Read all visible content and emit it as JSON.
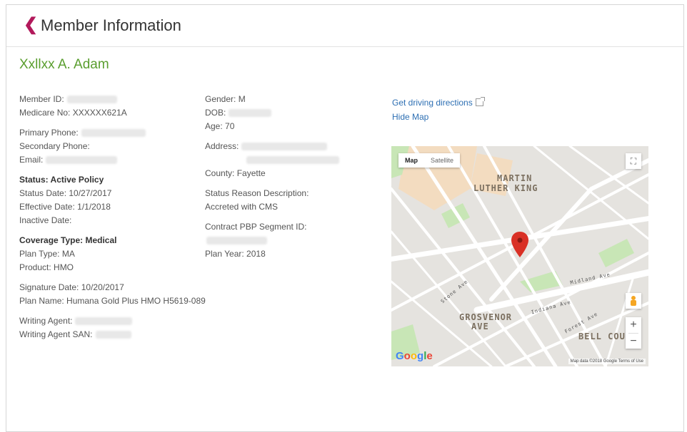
{
  "header": {
    "back_icon": "chevron-left-icon",
    "title": "Member Information"
  },
  "member": {
    "name": "Xxllxx A. Adam"
  },
  "left": {
    "member_id_label": "Member ID:",
    "medicare_label": "Medicare No: XXXXXX621A",
    "primary_phone_label": "Primary Phone:",
    "secondary_phone_label": "Secondary Phone:",
    "email_label": "Email:",
    "status_heading": "Status: Active Policy",
    "status_date": "Status Date: 10/27/2017",
    "effective_date": "Effective Date: 1/1/2018",
    "inactive_date": "Inactive Date:",
    "coverage_heading": "Coverage Type: Medical",
    "plan_type": "Plan Type: MA",
    "product": "Product: HMO",
    "signature_date": "Signature Date: 10/20/2017",
    "plan_name": "Plan Name: Humana Gold Plus HMO H5619-089",
    "writing_agent": "Writing Agent:",
    "writing_agent_san": "Writing Agent SAN:"
  },
  "middle": {
    "gender": "Gender: M",
    "dob_label": "DOB:",
    "age": "Age: 70",
    "address_label": "Address:",
    "county": "County: Fayette",
    "status_reason_label": "Status Reason Description:",
    "status_reason_value": "Accreted with CMS",
    "contract_label": "Contract PBP Segment ID:",
    "plan_year": "Plan Year: 2018"
  },
  "links": {
    "directions": "Get driving directions",
    "directions_icon": "external-link-icon",
    "hide_map": "Hide Map"
  },
  "map": {
    "type_map": "Map",
    "type_satellite": "Satellite",
    "labels": {
      "mlk1": "MARTIN",
      "mlk2": "LUTHER KING",
      "grosvenor1": "GROSVENOR",
      "grosvenor2": "AVE",
      "bell": "BELL COU",
      "midland": "Midland Ave",
      "indiana": "Indiana Ave",
      "stone": "Stone Ave",
      "forest": "Forest Ave"
    },
    "logo": [
      "G",
      "o",
      "o",
      "g",
      "l",
      "e"
    ],
    "attribution": "Map data ©2018 Google   Terms of Use",
    "marker_color": "#d93025"
  }
}
